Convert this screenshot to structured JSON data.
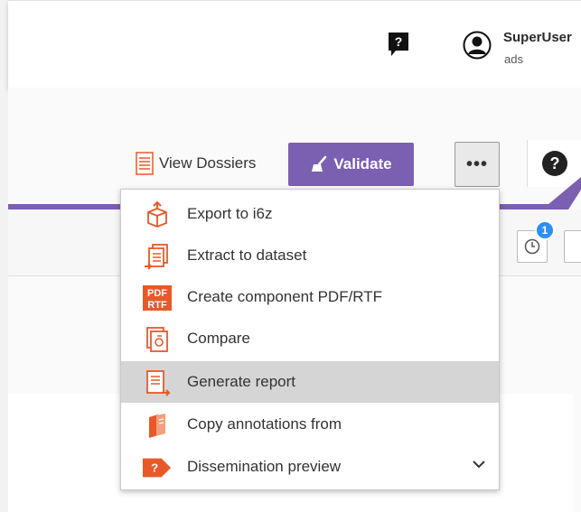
{
  "header": {
    "user_name": "SuperUser",
    "user_sub": "ads",
    "help_icon": "question-chat-icon",
    "avatar_icon": "user-avatar-icon"
  },
  "toolbar": {
    "view_dossiers_label": "View Dossiers",
    "validate_label": "Validate",
    "more_label": "•••",
    "help_icon": "question-circle-icon",
    "history_badge_count": "1",
    "accent_color": "#7b5fb0"
  },
  "menu": {
    "items": [
      {
        "label": "Export to i6z",
        "icon": "export-cube-icon"
      },
      {
        "label": "Extract to dataset",
        "icon": "extract-documents-icon"
      },
      {
        "label": "Create component PDF/RTF",
        "icon": "pdf-rtf-icon"
      },
      {
        "label": "Compare",
        "icon": "compare-icon"
      },
      {
        "label": "Generate report",
        "icon": "report-icon"
      },
      {
        "label": "Copy annotations from",
        "icon": "copy-annotations-icon"
      },
      {
        "label": "Dissemination preview",
        "icon": "dissemination-arrow-icon"
      }
    ],
    "selected_item": "Generate report",
    "icon_color": "#e8592a"
  }
}
